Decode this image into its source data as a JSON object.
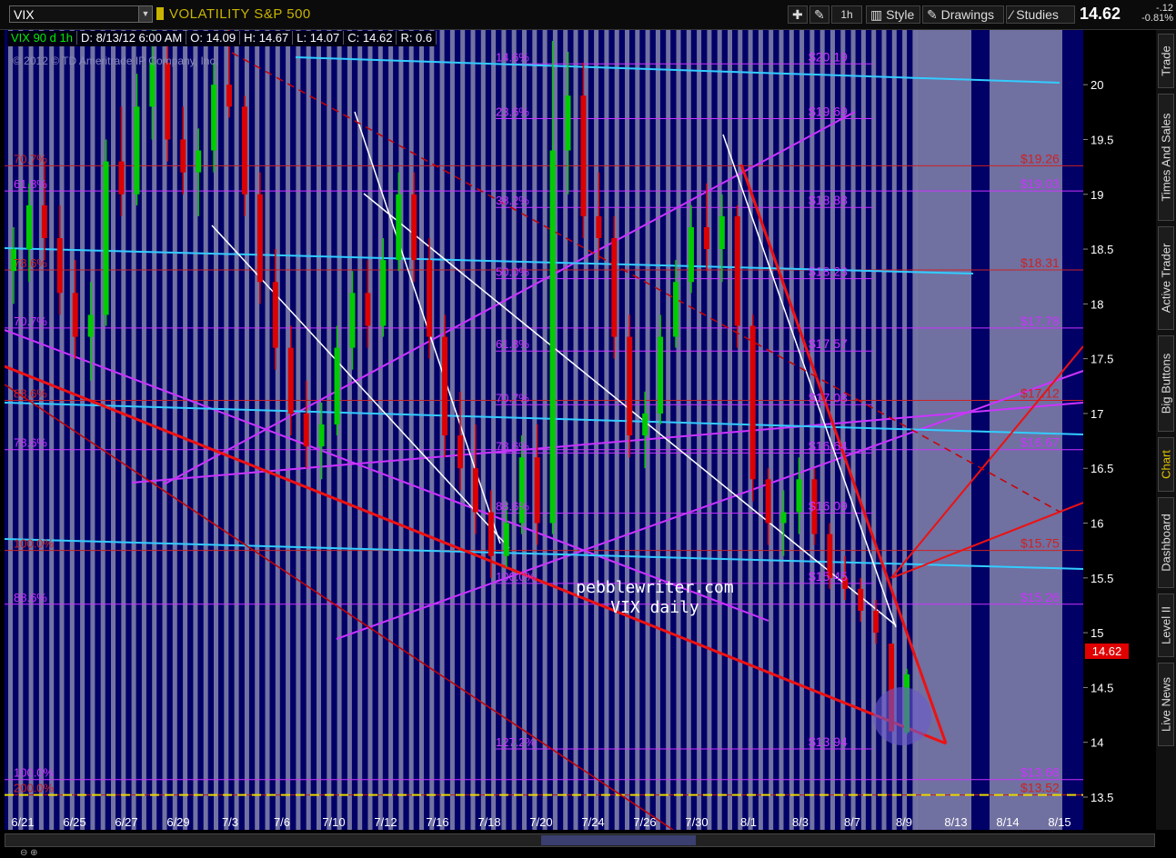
{
  "toolbar": {
    "symbol": "VIX",
    "security_name": "VOLATILITY S&P 500",
    "interval": "1h",
    "style_label": "Style",
    "drawings_label": "Drawings",
    "studies_label": "Studies",
    "last_price": "14.62",
    "change": "-.12",
    "change_pct": "-0.81%"
  },
  "infobar": {
    "name": "VIX 90 d 1h",
    "date": "D: 8/13/12 6:00 AM",
    "open": "O: 14.09",
    "high": "H: 14.67",
    "low": "L: 14.07",
    "close": "C: 14.62",
    "range": "R: 0.6"
  },
  "copyright": "© 2012 © TD Ameritrade IP Company, Inc.",
  "watermark": {
    "line1": "pebblewriter.com",
    "line2": "VIX daily"
  },
  "price_tag": "14.62",
  "side_tabs": [
    "Trade",
    "Times And Sales",
    "Active Trader",
    "Big Buttons",
    "Chart",
    "Dashboard",
    "Level II",
    "Live News"
  ],
  "colors": {
    "background": "#000066",
    "up": "#00cc00",
    "down": "#dd0000",
    "fib_magenta": "#cc33ff",
    "fib_red": "#cc2222",
    "cyan": "#33ccff",
    "white": "#ffffff",
    "yellow": "#e6d800"
  },
  "chart_data": {
    "type": "candlestick",
    "title": "",
    "ylim": [
      13.5,
      20.3
    ],
    "y_ticks": [
      "13.5",
      "14",
      "14.5",
      "15",
      "15.5",
      "16",
      "16.5",
      "17",
      "17.5",
      "18",
      "18.5",
      "19",
      "19.5",
      "20"
    ],
    "x_ticks": [
      "6/21",
      "6/25",
      "6/27",
      "6/29",
      "7/3",
      "7/6",
      "7/10",
      "7/12",
      "7/16",
      "7/18",
      "7/20",
      "7/24",
      "7/26",
      "7/30",
      "8/1",
      "8/3",
      "8/7",
      "8/9",
      "8/13",
      "8/14",
      "8/15"
    ],
    "fib_levels_magenta": [
      {
        "label": "14.6%",
        "value": 20.19
      },
      {
        "label": "23.6%",
        "value": 19.69
      },
      {
        "label": "38.2%",
        "value": 18.88
      },
      {
        "label": "50.0%",
        "value": 18.23
      },
      {
        "label": "61.8%",
        "value": 17.57
      },
      {
        "label": "70.7%",
        "value": 17.08
      },
      {
        "label": "78.6%",
        "value": 16.64
      },
      {
        "label": "88.6%",
        "value": 16.09
      },
      {
        "label": "100.0%",
        "value": 15.45
      },
      {
        "label": "127.2%",
        "value": 13.94
      }
    ],
    "left_fib_labels": [
      {
        "label": "70.7%",
        "value": 19.26,
        "color": "red"
      },
      {
        "label": "61.8%",
        "value": 19.03,
        "color": "magenta"
      },
      {
        "label": "78.6%",
        "value": 18.31,
        "color": "red"
      },
      {
        "label": "70.7%",
        "value": 17.78,
        "color": "magenta"
      },
      {
        "label": "88.6%",
        "value": 17.12,
        "color": "red"
      },
      {
        "label": "78.6%",
        "value": 16.67,
        "color": "magenta"
      },
      {
        "label": "100.0%",
        "value": 15.75,
        "color": "red"
      },
      {
        "label": "88.6%",
        "value": 15.26,
        "color": "magenta"
      },
      {
        "label": "100.0%",
        "value": 13.66,
        "color": "magenta"
      },
      {
        "label": "200.0%",
        "value": 13.52,
        "color": "red"
      }
    ],
    "right_level_labels": [
      {
        "text": "$20.19",
        "value": 20.19,
        "color": "magenta"
      },
      {
        "text": "$19.69",
        "value": 19.69,
        "color": "magenta"
      },
      {
        "text": "$19.26",
        "value": 19.26,
        "color": "red"
      },
      {
        "text": "$19.03",
        "value": 19.03,
        "color": "magenta"
      },
      {
        "text": "$18.88",
        "value": 18.88,
        "color": "magenta"
      },
      {
        "text": "$18.31",
        "value": 18.31,
        "color": "red"
      },
      {
        "text": "$18.23",
        "value": 18.23,
        "color": "magenta"
      },
      {
        "text": "$17.78",
        "value": 17.78,
        "color": "magenta"
      },
      {
        "text": "$17.57",
        "value": 17.57,
        "color": "magenta"
      },
      {
        "text": "$17.12",
        "value": 17.12,
        "color": "red"
      },
      {
        "text": "$17.08",
        "value": 17.08,
        "color": "magenta"
      },
      {
        "text": "$16.67",
        "value": 16.67,
        "color": "magenta"
      },
      {
        "text": "$16.64",
        "value": 16.64,
        "color": "magenta"
      },
      {
        "text": "$16.09",
        "value": 16.09,
        "color": "magenta"
      },
      {
        "text": "$15.75",
        "value": 15.75,
        "color": "red"
      },
      {
        "text": "$15.45",
        "value": 15.45,
        "color": "magenta"
      },
      {
        "text": "$15.26",
        "value": 15.26,
        "color": "magenta"
      },
      {
        "text": "$13.94",
        "value": 13.94,
        "color": "magenta"
      },
      {
        "text": "$13.66",
        "value": 13.66,
        "color": "magenta"
      },
      {
        "text": "$13.52",
        "value": 13.52,
        "color": "red"
      }
    ],
    "series": [
      {
        "name": "VIX",
        "values": [
          [
            0,
            18.3,
            18.7,
            18.0,
            18.5
          ],
          [
            1,
            18.5,
            19.1,
            18.2,
            18.9
          ],
          [
            2,
            18.9,
            19.3,
            18.4,
            18.6
          ],
          [
            3,
            18.6,
            18.9,
            17.9,
            18.1
          ],
          [
            4,
            18.1,
            18.4,
            17.5,
            17.7
          ],
          [
            5,
            17.7,
            18.2,
            17.3,
            17.9
          ],
          [
            6,
            17.9,
            19.5,
            17.8,
            19.3
          ],
          [
            7,
            19.3,
            19.8,
            18.8,
            19.0
          ],
          [
            8,
            19.0,
            20.1,
            18.9,
            19.8
          ],
          [
            9,
            19.8,
            20.6,
            19.5,
            20.2
          ],
          [
            10,
            20.2,
            20.4,
            19.3,
            19.5
          ],
          [
            11,
            19.5,
            19.8,
            19.0,
            19.2
          ],
          [
            12,
            19.2,
            19.6,
            18.8,
            19.4
          ],
          [
            13,
            19.4,
            20.2,
            19.2,
            20.0
          ],
          [
            14,
            20.0,
            20.5,
            19.7,
            19.8
          ],
          [
            15,
            19.8,
            19.9,
            18.8,
            19.0
          ],
          [
            16,
            19.0,
            19.2,
            18.0,
            18.2
          ],
          [
            17,
            18.2,
            18.5,
            17.4,
            17.6
          ],
          [
            18,
            17.6,
            17.8,
            16.8,
            17.0
          ],
          [
            19,
            17.0,
            17.3,
            16.5,
            16.7
          ],
          [
            20,
            16.7,
            17.1,
            16.4,
            16.9
          ],
          [
            21,
            16.9,
            17.8,
            16.8,
            17.6
          ],
          [
            22,
            17.6,
            18.3,
            17.4,
            18.1
          ],
          [
            23,
            18.1,
            18.4,
            17.6,
            17.8
          ],
          [
            24,
            17.8,
            18.6,
            17.7,
            18.4
          ],
          [
            25,
            18.4,
            19.2,
            18.3,
            19.0
          ],
          [
            26,
            19.0,
            19.2,
            18.2,
            18.4
          ],
          [
            27,
            18.4,
            18.6,
            17.5,
            17.7
          ],
          [
            28,
            17.7,
            17.9,
            16.6,
            16.8
          ],
          [
            29,
            16.8,
            17.2,
            16.3,
            16.5
          ],
          [
            30,
            16.5,
            16.9,
            15.9,
            16.1
          ],
          [
            31,
            16.1,
            16.3,
            15.5,
            15.7
          ],
          [
            32,
            15.7,
            16.2,
            15.6,
            16.0
          ],
          [
            33,
            16.0,
            16.8,
            15.9,
            16.6
          ],
          [
            34,
            16.6,
            16.9,
            15.8,
            16.0
          ],
          [
            35,
            16.0,
            20.4,
            15.9,
            19.4
          ],
          [
            36,
            19.4,
            20.3,
            19.0,
            19.9
          ],
          [
            37,
            19.9,
            20.2,
            18.6,
            18.8
          ],
          [
            38,
            18.8,
            19.2,
            18.4,
            18.6
          ],
          [
            39,
            18.6,
            18.8,
            17.5,
            17.7
          ],
          [
            40,
            17.7,
            17.9,
            16.6,
            16.8
          ],
          [
            41,
            16.8,
            17.2,
            16.5,
            17.0
          ],
          [
            42,
            17.0,
            17.9,
            16.9,
            17.7
          ],
          [
            43,
            17.7,
            18.4,
            17.6,
            18.2
          ],
          [
            44,
            18.2,
            18.9,
            18.1,
            18.7
          ],
          [
            45,
            18.7,
            19.1,
            18.3,
            18.5
          ],
          [
            46,
            18.5,
            19.0,
            18.2,
            18.8
          ],
          [
            47,
            18.8,
            18.9,
            17.6,
            17.8
          ],
          [
            48,
            17.8,
            17.9,
            16.2,
            16.4
          ],
          [
            49,
            16.4,
            16.5,
            15.8,
            16.0
          ],
          [
            50,
            16.0,
            16.3,
            15.7,
            16.1
          ],
          [
            51,
            16.1,
            16.6,
            15.9,
            16.4
          ],
          [
            52,
            16.4,
            16.5,
            15.8,
            15.9
          ],
          [
            53,
            15.9,
            16.0,
            15.4,
            15.5
          ],
          [
            54,
            15.5,
            15.7,
            15.3,
            15.4
          ],
          [
            55,
            15.4,
            15.5,
            15.1,
            15.2
          ],
          [
            56,
            15.2,
            15.3,
            14.9,
            15.0
          ],
          [
            57,
            14.9,
            14.9,
            14.1,
            14.1
          ],
          [
            58,
            14.09,
            14.67,
            14.07,
            14.62
          ]
        ]
      }
    ],
    "annotations": [
      "pebblewriter.com",
      "VIX daily"
    ]
  }
}
